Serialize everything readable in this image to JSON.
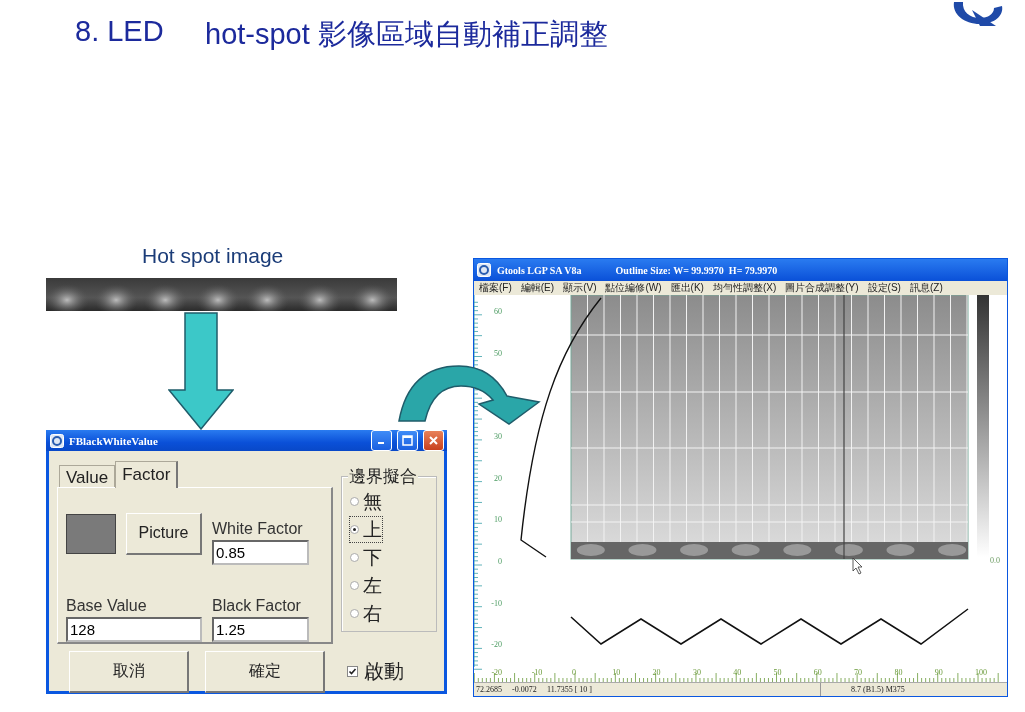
{
  "slide": {
    "number": "8. LED",
    "title": "hot-spot 影像區域自動補正調整",
    "image_caption": "Hot spot image"
  },
  "dialog": {
    "title": "FBlackWhiteValue",
    "tabs": [
      {
        "label": "Value",
        "selected": false
      },
      {
        "label": "Factor",
        "selected": true
      }
    ],
    "picture_button": "Picture",
    "fields": [
      {
        "label": "White Factor",
        "value": "0.85"
      },
      {
        "label": "Base Value",
        "value": "128"
      },
      {
        "label": "Black Factor",
        "value": "1.25"
      }
    ],
    "group": {
      "title": "邊界擬合",
      "options": [
        {
          "label": "無",
          "selected": false
        },
        {
          "label": "上",
          "selected": true
        },
        {
          "label": "下",
          "selected": false
        },
        {
          "label": "左",
          "selected": false
        },
        {
          "label": "右",
          "selected": false
        }
      ]
    },
    "buttons": [
      "取消",
      "確定"
    ],
    "enable": {
      "label": "啟動",
      "checked": true
    }
  },
  "app_window": {
    "title": "Gtools LGP SA V8a",
    "outline_size": "Outline Size: W= 99.9970  H= 79.9970",
    "menu": [
      "檔案(F)",
      "編輯(E)",
      "顯示(V)",
      "點位編修(W)",
      "匯出(K)",
      "均勻性調整(X)",
      "圖片合成調整(Y)",
      "設定(S)",
      "訊息(Z)"
    ],
    "vertical_ruler": [
      "60",
      "50",
      "30",
      "20",
      "10",
      "0",
      "-10",
      "-20"
    ],
    "horizontal_ruler": [
      "-20",
      "-10",
      "0",
      "10",
      "20",
      "30",
      "40",
      "50",
      "60",
      "70",
      "80",
      "90",
      "100"
    ],
    "colorbar_label": "0.0",
    "status_bar": [
      "72.2685",
      "-0.0072",
      "11.7355 [ 10 ]",
      "8.7 (B1.5) M375"
    ]
  }
}
